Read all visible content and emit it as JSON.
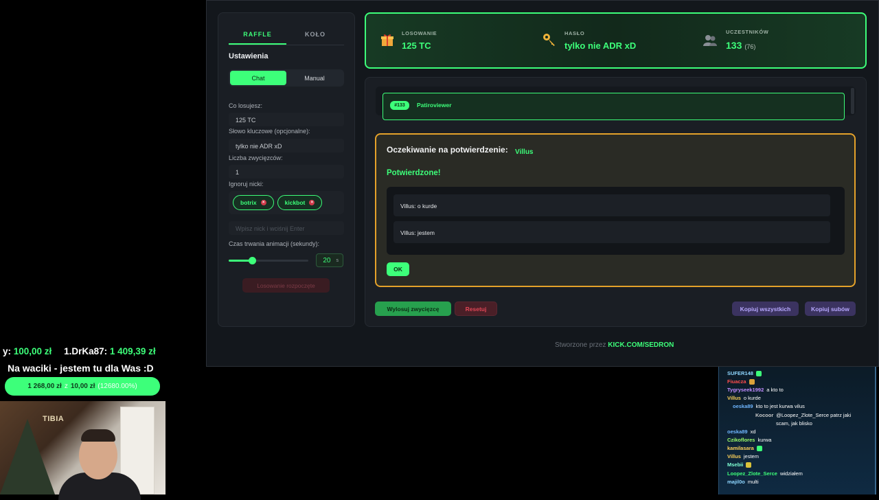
{
  "sidebar": {
    "tabs": [
      "RAFFLE",
      "KOŁO"
    ],
    "settings_title": "Ustawienia",
    "modes": [
      "Chat",
      "Manual"
    ],
    "prize_label": "Co losujesz:",
    "prize_value": "125 TC",
    "keyword_label": "Słowo kluczowe (opcjonalne):",
    "keyword_value": "tylko nie ADR xD",
    "winners_label": "Liczba zwycięzców:",
    "winners_value": "1",
    "ignore_label": "Ignoruj nicki:",
    "ignored_nicks": [
      "botrix",
      "kickbot"
    ],
    "nick_placeholder": "Wpisz nick i wciśnij Enter",
    "duration_label": "Czas trwania animacji (sekundy):",
    "duration_value": "20",
    "duration_unit": "s",
    "slider_fraction": 0.25,
    "started_label": "Losowanie rozpoczęte"
  },
  "stats": {
    "draw_label": "LOSOWANIE",
    "draw_value": "125 TC",
    "password_label": "HASŁO",
    "password_value": "tylko nie ADR xD",
    "participants_label": "UCZESTNIKÓW",
    "participants_value": "133",
    "participants_sub": "(76)",
    "icons": [
      "gift-icon",
      "key-icon",
      "users-icon"
    ]
  },
  "participants": [
    {
      "badge": "#133",
      "name": "Patiroviewer"
    }
  ],
  "confirmation": {
    "title": "Oczekiwanie na potwierdzenie:",
    "user": "Villus",
    "status": "Potwierdzone!",
    "messages": [
      "Villus: o kurde",
      "Villus: jestem"
    ],
    "ok_label": "OK"
  },
  "actions": {
    "draw_winner": "Wylosuj zwycięzcę",
    "reset": "Resetuj",
    "copy_all": "Kopiuj wszystkich",
    "copy_subs": "Kopiuj subów"
  },
  "footer": {
    "text": "Stworzone przez ",
    "link": "KICK.COM/SEDRON"
  },
  "overlay": {
    "donor1_name": "y: ",
    "donor1_amount": "100,00 zł",
    "donor2_name": "1.DrKa87: ",
    "donor2_amount": "1 409,39 zł",
    "goal_title": "Na waciki - jestem tu dla Was :D",
    "goal_progress": "1 268,00 zł",
    "goal_separator": "z",
    "goal_target": "10,00 zł",
    "goal_percent": "(12680.00%)",
    "webcam_text": "TIBIA"
  },
  "chat": [
    {
      "user": "SUFER148",
      "color": "#8fd7ff",
      "text": "",
      "badge": "#3dff7a"
    },
    {
      "user": "Fiuacza",
      "color": "#ff4d4d",
      "text": "",
      "badge": "#d9a23a"
    },
    {
      "user": "Tygryseek1992",
      "color": "#c08cff",
      "text": "a kto to",
      "badge": ""
    },
    {
      "user": "Villus",
      "color": "#ffd35a",
      "text": "o kurde",
      "badge": ""
    },
    {
      "user": "oeska89",
      "color": "#6fb6ff",
      "text": "kto to jest kurwa vilus",
      "badge": ""
    },
    {
      "user": "Kocoor",
      "color": "#c9c9c9",
      "text": "@Loopez_Zlote_Serce patrz jaki",
      "badge": ""
    },
    {
      "user": "",
      "color": "#ffffff",
      "text": "scam, jak blisko",
      "badge": ""
    },
    {
      "user": "oeska89",
      "color": "#6fb6ff",
      "text": "xd",
      "badge": ""
    },
    {
      "user": "Czikoflores",
      "color": "#9dff6a",
      "text": "kurwa",
      "badge": ""
    },
    {
      "user": "kamilasara",
      "color": "#ffd35a",
      "text": "",
      "badge": "#3dff7a"
    },
    {
      "user": "Villus",
      "color": "#ffd35a",
      "text": "jestem",
      "badge": ""
    },
    {
      "user": "Msebii",
      "color": "#7fffd4",
      "text": "",
      "badge": "#d9c23a"
    },
    {
      "user": "Loopez_Zlote_Serce",
      "color": "#3dff7a",
      "text": "widziałem",
      "badge": ""
    },
    {
      "user": "majil0o",
      "color": "#8fd7ff",
      "text": "multi",
      "badge": ""
    }
  ]
}
